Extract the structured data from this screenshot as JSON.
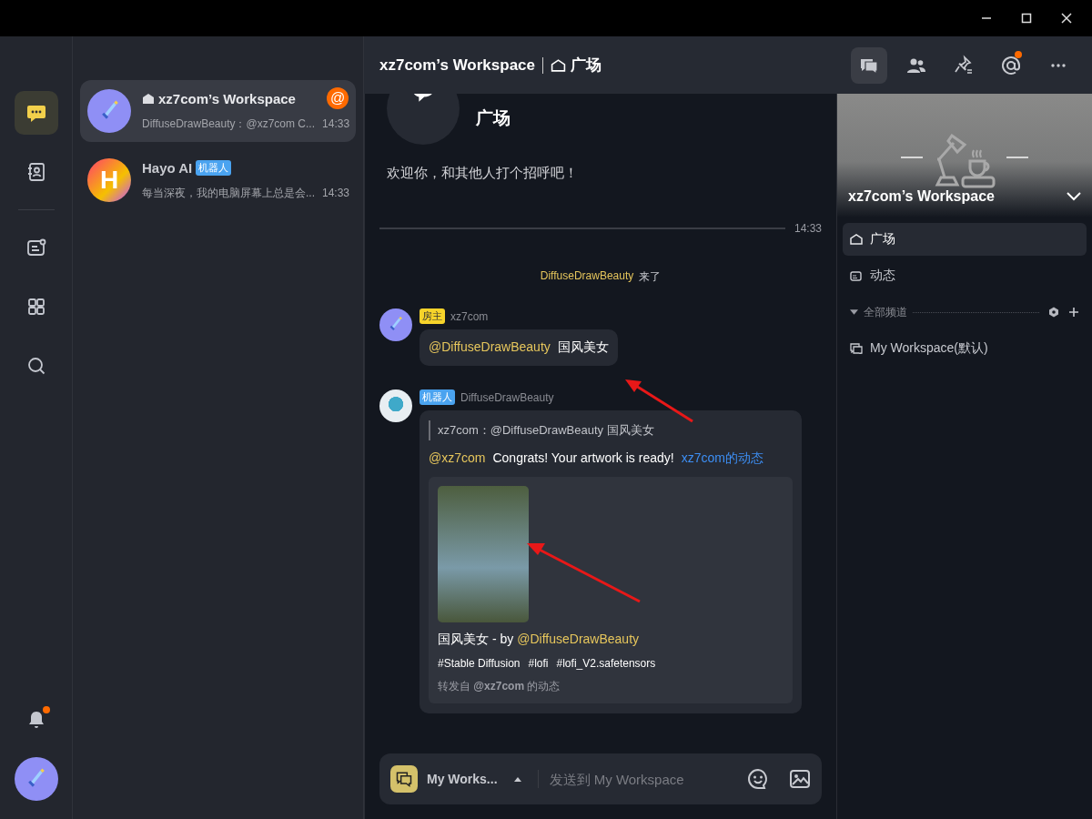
{
  "rail": {
    "items": [
      {
        "kind": "chat",
        "selected": true
      },
      {
        "kind": "contacts",
        "selected": false
      },
      {
        "kind": "feed",
        "selected": false
      },
      {
        "kind": "apps",
        "selected": false
      },
      {
        "kind": "search",
        "selected": false
      }
    ],
    "bell_badge": true
  },
  "conversations": [
    {
      "name": "xz7com’s Workspace",
      "home": true,
      "preview": "DiffuseDrawBeauty：@xz7com C...",
      "time": "14:33",
      "badge": "@",
      "selected": true
    },
    {
      "name": "Hayo AI",
      "tag": {
        "text": "机器人",
        "kind": "bot"
      },
      "preview": "每当深夜，我的电脑屏幕上总是会...",
      "time": "14:33",
      "selected": false,
      "letter": "H"
    }
  ],
  "header": {
    "workspace": "xz7com’s Workspace",
    "channel": "广场"
  },
  "toolbar": [
    {
      "kind": "chat",
      "selected": true
    },
    {
      "kind": "people",
      "selected": false
    },
    {
      "kind": "pin",
      "selected": false
    },
    {
      "kind": "at",
      "selected": false,
      "badge": true
    },
    {
      "kind": "more",
      "selected": false
    }
  ],
  "intro": {
    "name": "广场",
    "welcome": "欢迎你，和其他人打个招呼吧！"
  },
  "time_divider": "14:33",
  "messages": [
    {
      "kind": "system",
      "user": "DiffuseDrawBeauty",
      "text": "来了"
    },
    {
      "kind": "chat",
      "tag": {
        "text": "房主",
        "kind": "owner"
      },
      "author": "xz7com",
      "mention": "@DiffuseDrawBeauty",
      "text": "国风美女"
    },
    {
      "kind": "card",
      "tag": {
        "text": "机器人",
        "kind": "bot"
      },
      "author": "DiffuseDrawBeauty",
      "quote": "xz7com：@DiffuseDrawBeauty 国风美女",
      "mention": "@xz7com",
      "text": "Congrats! Your artwork is ready!",
      "link": "xz7com的动态",
      "caption": "国风美女 - by",
      "caption_mention": "@DiffuseDrawBeauty",
      "hashtags": [
        "#Stable Diffusion",
        "#lofi",
        "#lofi_V2.safetensors"
      ],
      "repost": "转发自 **@xz7com** 的动态"
    }
  ],
  "composer": {
    "channel": "My Works...",
    "placeholder": "发送到 My Workspace"
  },
  "panel": {
    "title": "xz7com’s Workspace",
    "nav": [
      {
        "label": "广场",
        "kind": "home",
        "selected": true
      },
      {
        "label": "动态",
        "kind": "feed",
        "selected": false
      }
    ],
    "section": "全部频道",
    "channels": [
      {
        "label": "My Workspace(默认)"
      }
    ]
  }
}
